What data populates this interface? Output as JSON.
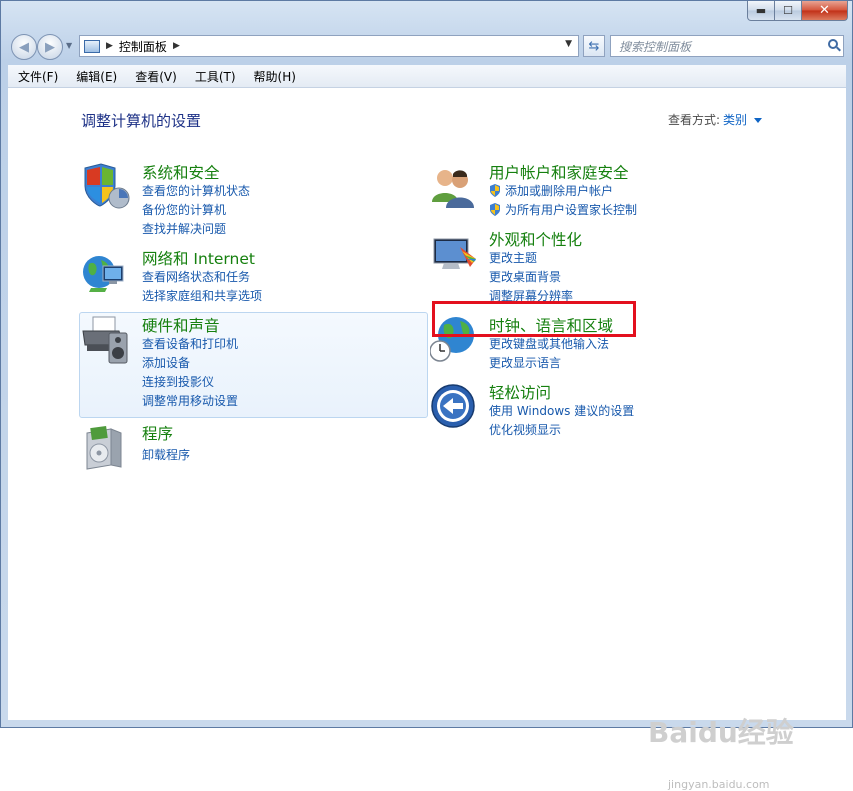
{
  "window": {
    "minimize": "▬",
    "maximize": "☐",
    "close": "✕"
  },
  "nav": {
    "address_label": "控制面板",
    "search_placeholder": "搜索控制面板"
  },
  "menu": [
    "文件(F)",
    "编辑(E)",
    "查看(V)",
    "工具(T)",
    "帮助(H)"
  ],
  "content": {
    "heading": "调整计算机的设置",
    "view_by_label": "查看方式:",
    "view_by_value": "类别"
  },
  "categories": {
    "system": {
      "title": "系统和安全",
      "links": [
        "查看您的计算机状态",
        "备份您的计算机",
        "查找并解决问题"
      ]
    },
    "network": {
      "title": "网络和 Internet",
      "links": [
        "查看网络状态和任务",
        "选择家庭组和共享选项"
      ]
    },
    "hardware": {
      "title": "硬件和声音",
      "links": [
        "查看设备和打印机",
        "添加设备",
        "连接到投影仪",
        "调整常用移动设置"
      ]
    },
    "programs": {
      "title": "程序",
      "links": [
        "卸载程序"
      ]
    },
    "users": {
      "title": "用户帐户和家庭安全",
      "links": [
        "添加或删除用户帐户",
        "为所有用户设置家长控制"
      ]
    },
    "appearance": {
      "title": "外观和个性化",
      "links": [
        "更改主题",
        "更改桌面背景",
        "调整屏幕分辨率"
      ]
    },
    "clock": {
      "title": "时钟、语言和区域",
      "links": [
        "更改键盘或其他输入法",
        "更改显示语言"
      ]
    },
    "ease": {
      "title": "轻松访问",
      "links": [
        "使用 Windows 建议的设置",
        "优化视频显示"
      ]
    }
  },
  "watermark": {
    "brand": "Baidu经验",
    "url": "jingyan.baidu.com"
  },
  "colors": {
    "title_green": "#16800f",
    "link_blue": "#1859ac",
    "highlight_red": "#e3101e"
  }
}
